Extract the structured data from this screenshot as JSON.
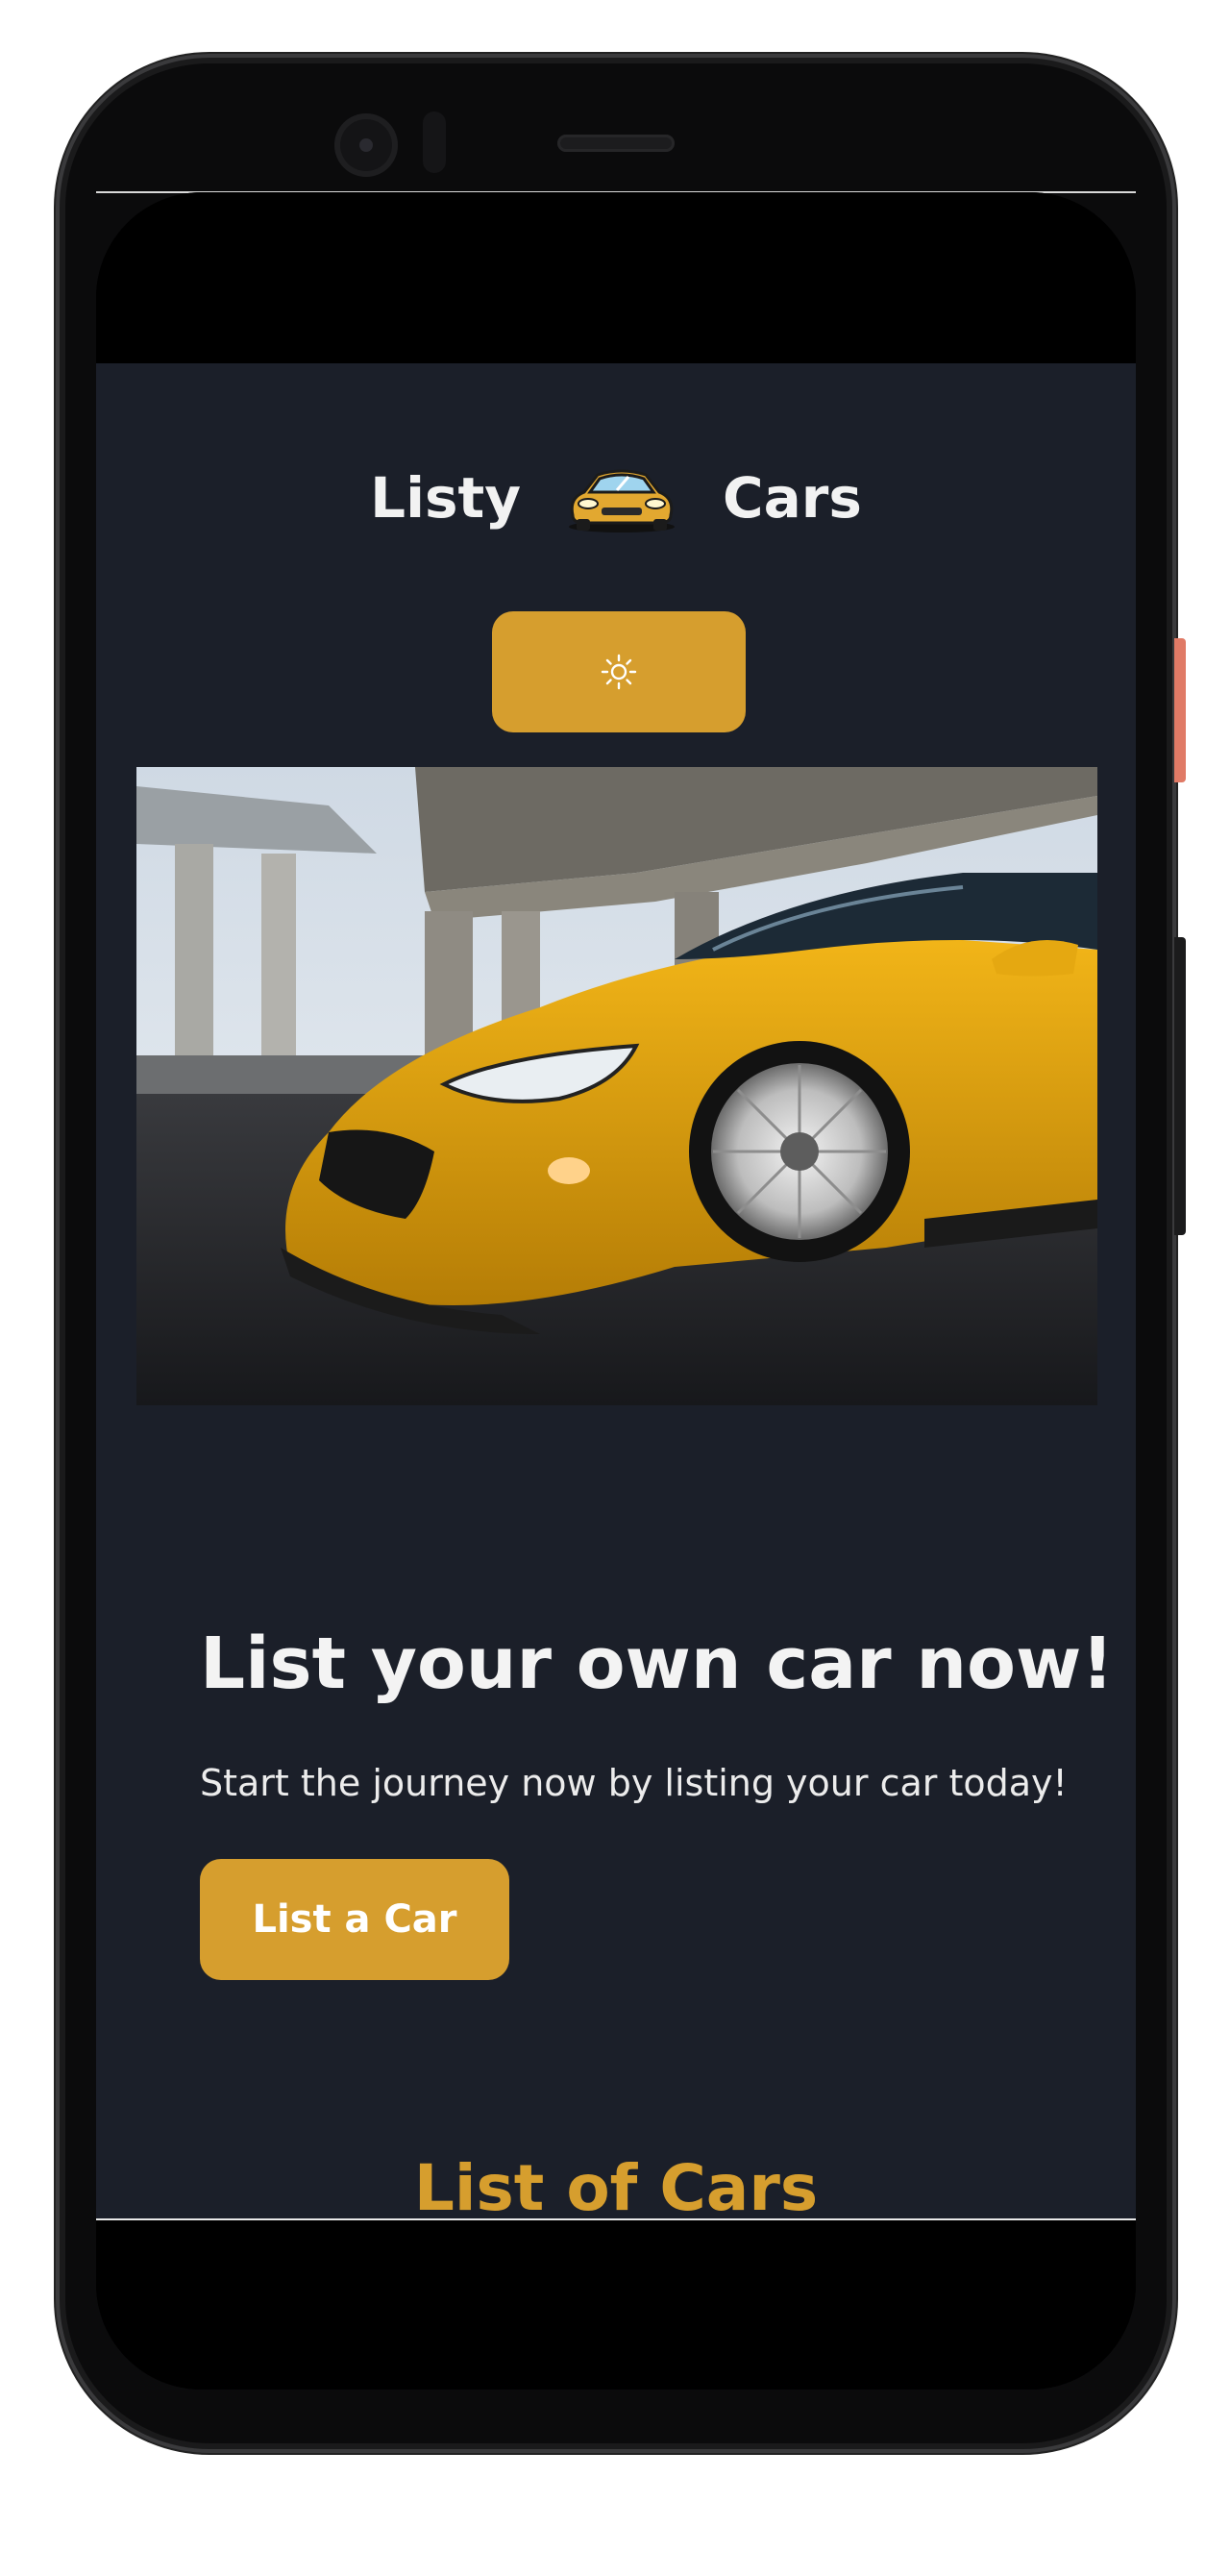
{
  "header": {
    "brand_left": "Listy",
    "brand_right": "Cars",
    "logo_icon": "sports-car-icon",
    "theme_toggle_icon": "sun-icon"
  },
  "hero": {
    "image": "yellow-sports-car-photo",
    "title": "List your own car now!",
    "subtitle": "Start the journey now by listing your car today!",
    "cta_label": "List a Car"
  },
  "cars_section": {
    "title": "List of Cars"
  },
  "colors": {
    "accent": "#d69e2e",
    "page_bg": "#1b1f29",
    "text": "#f2f2f2"
  }
}
